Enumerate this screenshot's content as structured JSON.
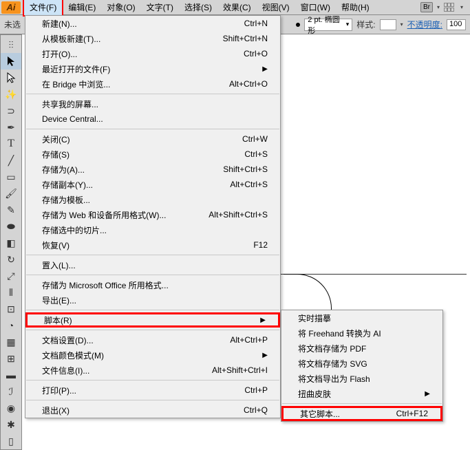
{
  "menubar": {
    "items": [
      {
        "label": "文件(F)"
      },
      {
        "label": "编辑(E)"
      },
      {
        "label": "对象(O)"
      },
      {
        "label": "文字(T)"
      },
      {
        "label": "选择(S)"
      },
      {
        "label": "效果(C)"
      },
      {
        "label": "视图(V)"
      },
      {
        "label": "窗口(W)"
      },
      {
        "label": "帮助(H)"
      }
    ],
    "br_badge": "Br"
  },
  "optionsbar": {
    "left_text": "未选",
    "stroke_value": "2 pt. 椭圆形",
    "style_label": "样式:",
    "opacity_label": "不透明度:",
    "opacity_value": "100"
  },
  "file_menu": [
    {
      "label": "新建(N)...",
      "shortcut": "Ctrl+N"
    },
    {
      "label": "从模板新建(T)...",
      "shortcut": "Shift+Ctrl+N"
    },
    {
      "label": "打开(O)...",
      "shortcut": "Ctrl+O"
    },
    {
      "label": "最近打开的文件(F)",
      "arrow": true
    },
    {
      "label": "在 Bridge 中浏览...",
      "shortcut": "Alt+Ctrl+O"
    },
    {
      "sep": true
    },
    {
      "label": "共享我的屏幕..."
    },
    {
      "label": "Device Central..."
    },
    {
      "sep": true
    },
    {
      "label": "关闭(C)",
      "shortcut": "Ctrl+W"
    },
    {
      "label": "存储(S)",
      "shortcut": "Ctrl+S"
    },
    {
      "label": "存储为(A)...",
      "shortcut": "Shift+Ctrl+S"
    },
    {
      "label": "存储副本(Y)...",
      "shortcut": "Alt+Ctrl+S"
    },
    {
      "label": "存储为模板..."
    },
    {
      "label": "存储为 Web 和设备所用格式(W)...",
      "shortcut": "Alt+Shift+Ctrl+S"
    },
    {
      "label": "存储选中的切片..."
    },
    {
      "label": "恢复(V)",
      "shortcut": "F12"
    },
    {
      "sep": true
    },
    {
      "label": "置入(L)..."
    },
    {
      "sep": true
    },
    {
      "label": "存储为 Microsoft Office 所用格式..."
    },
    {
      "label": "导出(E)..."
    },
    {
      "sep": true
    },
    {
      "label": "脚本(R)",
      "arrow": true,
      "highlight": true
    },
    {
      "sep": true
    },
    {
      "label": "文档设置(D)...",
      "shortcut": "Alt+Ctrl+P"
    },
    {
      "label": "文档颜色模式(M)",
      "arrow": true
    },
    {
      "label": "文件信息(I)...",
      "shortcut": "Alt+Shift+Ctrl+I"
    },
    {
      "sep": true
    },
    {
      "label": "打印(P)...",
      "shortcut": "Ctrl+P"
    },
    {
      "sep": true
    },
    {
      "label": "退出(X)",
      "shortcut": "Ctrl+Q"
    }
  ],
  "script_submenu": [
    {
      "label": "实时描摹"
    },
    {
      "label": "将 Freehand 转换为 AI"
    },
    {
      "label": "将文档存储为 PDF"
    },
    {
      "label": "将文档存储为 SVG"
    },
    {
      "label": "将文档导出为 Flash"
    },
    {
      "label": "扭曲皮肤",
      "arrow": true
    },
    {
      "sep": true
    },
    {
      "label": "其它脚本...",
      "shortcut": "Ctrl+F12",
      "highlight": true
    }
  ]
}
